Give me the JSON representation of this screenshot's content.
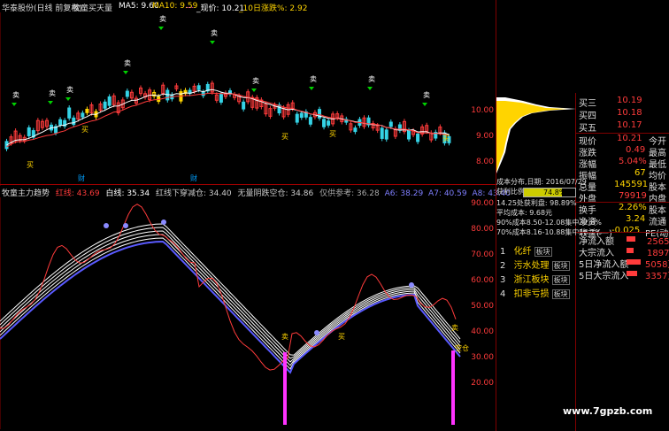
{
  "header": {
    "stock_title": "华泰股份(日线 前复权)",
    "indicator": "牧童买天量",
    "ma5_label": "MA5: 9.60",
    "ma10_label": "MA10: 9.59",
    "ma_extra": "...",
    "price_label": "_现价: 10.21",
    "change_label": "_10日涨跌%: 2.92"
  },
  "main_axis": {
    "ticks": [
      "10.00",
      "9.00",
      "8.00"
    ]
  },
  "main_labels": {
    "sell": "卖",
    "buy": "买",
    "cai": "财"
  },
  "sub_header": {
    "name": "牧童主力趋势",
    "red_line": "红线: 43.69",
    "white_line": "白线: 35.34",
    "cross": "红线下穿减仓: 34.40",
    "fish": "无量阴跌空仓: 34.86",
    "ref": "仅供参考: 36.28",
    "a6": "A6: 38.29",
    "a7": "A7: 40.59",
    "a8": "A8: 43.40"
  },
  "sub_axis": {
    "ticks": [
      "90.00",
      "80.00",
      "70.00",
      "60.00",
      "50.00",
      "40.00",
      "30.00",
      "20.00"
    ]
  },
  "sub_labels": {
    "sell": "卖",
    "buy": "买",
    "lightcang": "空仓"
  },
  "chip": {
    "title": "成本分布,日期: 2016/07/29",
    "profit_label": "获利比例:",
    "profit_value": "74.8%",
    "line1": "14.25处获利盘: 98.89%",
    "line2": "平均成本: 9.68元",
    "line3": "90%成本8.50-12.08集中32.8%",
    "line4": "70%成本8.16-10.88集中16.1%"
  },
  "quotes": {
    "asks": [
      {
        "label": "买三",
        "price": "10.19"
      },
      {
        "label": "买四",
        "price": "10.18"
      },
      {
        "label": "买五",
        "price": "10.17"
      }
    ],
    "rows": [
      {
        "k1": "现价",
        "v1": "10.21",
        "k2": "今开",
        "v2": ""
      },
      {
        "k1": "涨跌",
        "v1": "0.49",
        "k2": "最高",
        "v2": ""
      },
      {
        "k1": "涨幅",
        "v1": "5.04%",
        "k2": "最低",
        "v2": ""
      },
      {
        "k1": "振幅",
        "v1": "67",
        "k2": "均价",
        "v2": ""
      },
      {
        "k1": "总量",
        "v1": "145591",
        "k2": "股本",
        "v2": ""
      },
      {
        "k1": "外盘",
        "v1": "79919",
        "k2": "内盘",
        "v2": ""
      }
    ],
    "rows2": [
      {
        "k1": "换手",
        "v1": "2.26%",
        "k2": "股本",
        "v2": ""
      },
      {
        "k1": "净资",
        "v1": "3.24",
        "k2": "流通",
        "v2": ""
      },
      {
        "k1": "收益(一)",
        "v1": "-0.025",
        "k2": "PE(动)",
        "v2": ""
      }
    ]
  },
  "sectors": [
    {
      "num": "1",
      "name": "化纤",
      "tag": "板块"
    },
    {
      "num": "2",
      "name": "污水处理",
      "tag": "板块"
    },
    {
      "num": "3",
      "name": "浙江板块",
      "tag": "板块"
    },
    {
      "num": "4",
      "name": "扣非亏损",
      "tag": "板块"
    }
  ],
  "flows": [
    {
      "label": "净流入额",
      "value": "2565万"
    },
    {
      "label": "大宗流入",
      "value": "1897万"
    },
    {
      "label": "5日净流入额",
      "value": "5058万"
    },
    {
      "label": "5日大宗流入",
      "value": "3357万"
    }
  ],
  "watermark": "www.7gpzb.com",
  "colors": {
    "up": "#ff3b3b",
    "down": "#35d3e6",
    "yellow": "#ffd400",
    "purple": "#ff33ff",
    "blue": "#5a5aff",
    "ma": "#ffffff",
    "divider": "#800000"
  }
}
